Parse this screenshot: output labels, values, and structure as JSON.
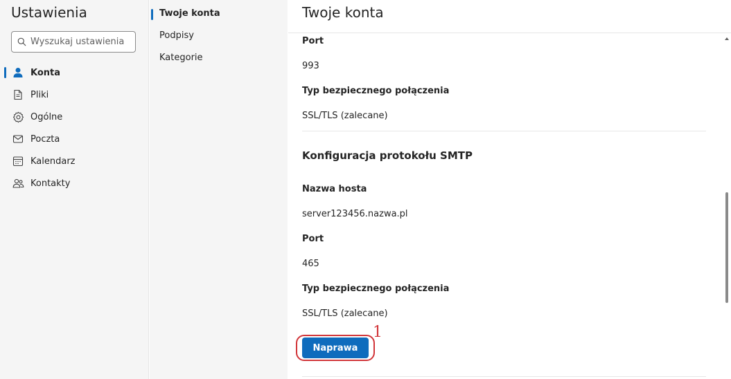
{
  "sidebar": {
    "title": "Ustawienia",
    "search_placeholder": "Wyszukaj ustawienia",
    "items": [
      {
        "label": "Konta",
        "icon": "person-icon"
      },
      {
        "label": "Pliki",
        "icon": "document-icon"
      },
      {
        "label": "Ogólne",
        "icon": "gear-icon"
      },
      {
        "label": "Poczta",
        "icon": "mail-icon"
      },
      {
        "label": "Kalendarz",
        "icon": "calendar-icon"
      },
      {
        "label": "Kontakty",
        "icon": "people-icon"
      }
    ]
  },
  "subnav": {
    "items": [
      {
        "label": "Twoje konta"
      },
      {
        "label": "Podpisy"
      },
      {
        "label": "Kategorie"
      }
    ]
  },
  "main": {
    "title": "Twoje konta",
    "imap_port_label": "Port",
    "imap_port_value": "993",
    "imap_security_label": "Typ bezpiecznego połączenia",
    "imap_security_value": "SSL/TLS (zalecane)",
    "smtp_section_title": "Konfiguracja protokołu SMTP",
    "smtp_host_label": "Nazwa hosta",
    "smtp_host_value": "server123456.nazwa.pl",
    "smtp_port_label": "Port",
    "smtp_port_value": "465",
    "smtp_security_label": "Typ bezpiecznego połączenia",
    "smtp_security_value": "SSL/TLS (zalecane)",
    "fix_button_label": "Naprawa",
    "annotation_number": "1"
  },
  "colors": {
    "accent": "#0f6cbd",
    "annotation": "#d13438"
  }
}
